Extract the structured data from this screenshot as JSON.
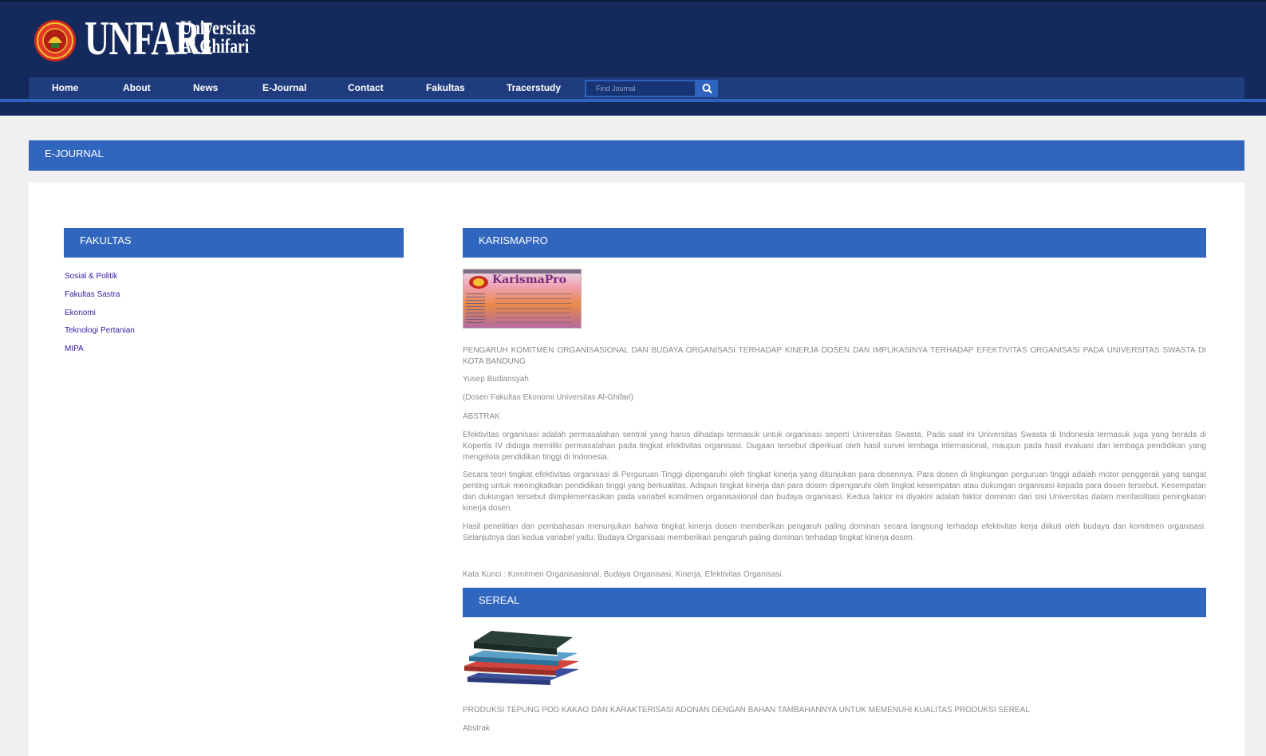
{
  "header": {
    "logo_main": "UNFARI",
    "logo_sub_line1": "Universitas",
    "logo_sub_line2": "Al Ghifari"
  },
  "nav": {
    "items": [
      {
        "label": "Home"
      },
      {
        "label": "About"
      },
      {
        "label": "News"
      },
      {
        "label": "E-Journal"
      },
      {
        "label": "Contact"
      },
      {
        "label": "Fakultas"
      },
      {
        "label": "Tracerstudy"
      }
    ],
    "search_placeholder": "Find Journal",
    "search_icon": "search-icon"
  },
  "page_title": "E-JOURNAL",
  "sidebar": {
    "heading": "FAKULTAS",
    "links": [
      {
        "label": "Sosial & Politik"
      },
      {
        "label": "Fakultas Sastra"
      },
      {
        "label": "Ekonomi"
      },
      {
        "label": "Teknologi Pertanian"
      },
      {
        "label": "MIPA"
      }
    ]
  },
  "journals": [
    {
      "heading": "KARISMAPRO",
      "cover_title": "KarismaPro",
      "title": "PENGARUH KOMITMEN ORGANISASIONAL DAN BUDAYA ORGANISASI TERHADAP KINERJA DOSEN DAN IMPLIKASINYA TERHADAP EFEKTIVITAS ORGANISASI PADA UNIVERSITAS SWASTA DI KOTA BANDUNG",
      "author": "Yusep Budiansyah",
      "affiliation": "(Dosen Fakultas Ekonomi Universitas Al-Ghifari)",
      "abstract_label": "ABSTRAK",
      "paragraphs": [
        "Efektivitas organisasi adalah permasalahan sentral yang harus dihadapi termasuk untuk organisasi seperti Universitas Swasta. Pada saat ini Universitas Swasta di Indonesia termasuk juga yang berada di Kopertis IV diduga memiliki permasalahan pada tingkat efektivitas organisasi. Dugaan tersebut diperkuat oleh hasil survei lembaga internasional, maupun pada hasil evaluasi dari lembaga pendidikan yang mengelola pendidikan tinggi di Indonesia.",
        "Secara teori tingkat efektivitas organisasi di Perguruan Tinggi dipengaruhi oleh tingkat kinerja yang ditunjukan para dosennya. Para dosen di lingkungan perguruan tinggi adalah motor penggerak yang sangat penting untuk meningkatkan pendidikan tinggi yang berkualitas. Adapun tingkat kinerja dari para dosen dipengaruhi oleh tingkat kesempatan atau dukungan organisasi kepada para dosen tersebut. Kesempatan dan dukungan tersebut diimplementasikan pada variabel komitmen organisasional dan budaya organisasi. Kedua faktor ini diyakini adalah faktor dominan dari sisi Universitas dalam menfasilitasi peningkatan kinerja dosen.",
        "Hasil penelitian dan pembahasan menunjukan bahwa tingkat kinerja dosen memberikan pengaruh paling dominan secara langsung terhadap efektivitas kerja diikuti oleh budaya dan komitmen organisasi. Selanjutnya dari kedua variabel yaitu; Budaya Organisasi memberikan pengaruh paling dominan terhadap tingkat kinerja dosen."
      ],
      "keywords": "Kata Kunci : Komitmen Organisasional, Budaya Organisasi, Kinerja, Efektivitas Organisasi."
    },
    {
      "heading": "SEREAL",
      "title": "PRODUKSI TEPUNG POD KAKAO DAN KARAKTERISASI ADONAN DENGAN BAHAN TAMBAHANNYA UNTUK MEMENUHI KUALITAS PRODUKSI SEREAL",
      "abstract_label": "Abstrak"
    }
  ]
}
